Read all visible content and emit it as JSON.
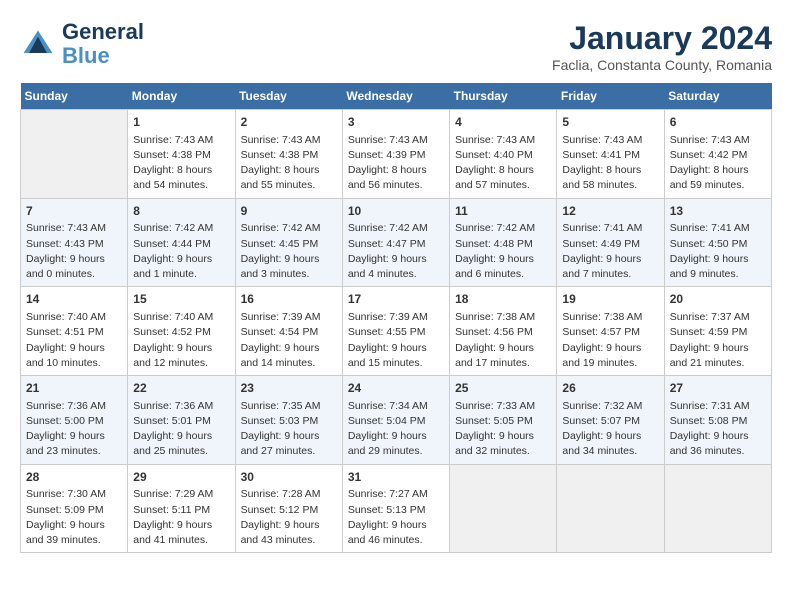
{
  "header": {
    "logo_line1": "General",
    "logo_line2": "Blue",
    "month_year": "January 2024",
    "location": "Faclia, Constanta County, Romania"
  },
  "weekdays": [
    "Sunday",
    "Monday",
    "Tuesday",
    "Wednesday",
    "Thursday",
    "Friday",
    "Saturday"
  ],
  "weeks": [
    [
      {
        "day": "",
        "empty": true
      },
      {
        "day": "1",
        "sunrise": "7:43 AM",
        "sunset": "4:38 PM",
        "daylight": "8 hours and 54 minutes."
      },
      {
        "day": "2",
        "sunrise": "7:43 AM",
        "sunset": "4:38 PM",
        "daylight": "8 hours and 55 minutes."
      },
      {
        "day": "3",
        "sunrise": "7:43 AM",
        "sunset": "4:39 PM",
        "daylight": "8 hours and 56 minutes."
      },
      {
        "day": "4",
        "sunrise": "7:43 AM",
        "sunset": "4:40 PM",
        "daylight": "8 hours and 57 minutes."
      },
      {
        "day": "5",
        "sunrise": "7:43 AM",
        "sunset": "4:41 PM",
        "daylight": "8 hours and 58 minutes."
      },
      {
        "day": "6",
        "sunrise": "7:43 AM",
        "sunset": "4:42 PM",
        "daylight": "8 hours and 59 minutes."
      }
    ],
    [
      {
        "day": "7",
        "sunrise": "7:43 AM",
        "sunset": "4:43 PM",
        "daylight": "9 hours and 0 minutes."
      },
      {
        "day": "8",
        "sunrise": "7:42 AM",
        "sunset": "4:44 PM",
        "daylight": "9 hours and 1 minute."
      },
      {
        "day": "9",
        "sunrise": "7:42 AM",
        "sunset": "4:45 PM",
        "daylight": "9 hours and 3 minutes."
      },
      {
        "day": "10",
        "sunrise": "7:42 AM",
        "sunset": "4:47 PM",
        "daylight": "9 hours and 4 minutes."
      },
      {
        "day": "11",
        "sunrise": "7:42 AM",
        "sunset": "4:48 PM",
        "daylight": "9 hours and 6 minutes."
      },
      {
        "day": "12",
        "sunrise": "7:41 AM",
        "sunset": "4:49 PM",
        "daylight": "9 hours and 7 minutes."
      },
      {
        "day": "13",
        "sunrise": "7:41 AM",
        "sunset": "4:50 PM",
        "daylight": "9 hours and 9 minutes."
      }
    ],
    [
      {
        "day": "14",
        "sunrise": "7:40 AM",
        "sunset": "4:51 PM",
        "daylight": "9 hours and 10 minutes."
      },
      {
        "day": "15",
        "sunrise": "7:40 AM",
        "sunset": "4:52 PM",
        "daylight": "9 hours and 12 minutes."
      },
      {
        "day": "16",
        "sunrise": "7:39 AM",
        "sunset": "4:54 PM",
        "daylight": "9 hours and 14 minutes."
      },
      {
        "day": "17",
        "sunrise": "7:39 AM",
        "sunset": "4:55 PM",
        "daylight": "9 hours and 15 minutes."
      },
      {
        "day": "18",
        "sunrise": "7:38 AM",
        "sunset": "4:56 PM",
        "daylight": "9 hours and 17 minutes."
      },
      {
        "day": "19",
        "sunrise": "7:38 AM",
        "sunset": "4:57 PM",
        "daylight": "9 hours and 19 minutes."
      },
      {
        "day": "20",
        "sunrise": "7:37 AM",
        "sunset": "4:59 PM",
        "daylight": "9 hours and 21 minutes."
      }
    ],
    [
      {
        "day": "21",
        "sunrise": "7:36 AM",
        "sunset": "5:00 PM",
        "daylight": "9 hours and 23 minutes."
      },
      {
        "day": "22",
        "sunrise": "7:36 AM",
        "sunset": "5:01 PM",
        "daylight": "9 hours and 25 minutes."
      },
      {
        "day": "23",
        "sunrise": "7:35 AM",
        "sunset": "5:03 PM",
        "daylight": "9 hours and 27 minutes."
      },
      {
        "day": "24",
        "sunrise": "7:34 AM",
        "sunset": "5:04 PM",
        "daylight": "9 hours and 29 minutes."
      },
      {
        "day": "25",
        "sunrise": "7:33 AM",
        "sunset": "5:05 PM",
        "daylight": "9 hours and 32 minutes."
      },
      {
        "day": "26",
        "sunrise": "7:32 AM",
        "sunset": "5:07 PM",
        "daylight": "9 hours and 34 minutes."
      },
      {
        "day": "27",
        "sunrise": "7:31 AM",
        "sunset": "5:08 PM",
        "daylight": "9 hours and 36 minutes."
      }
    ],
    [
      {
        "day": "28",
        "sunrise": "7:30 AM",
        "sunset": "5:09 PM",
        "daylight": "9 hours and 39 minutes."
      },
      {
        "day": "29",
        "sunrise": "7:29 AM",
        "sunset": "5:11 PM",
        "daylight": "9 hours and 41 minutes."
      },
      {
        "day": "30",
        "sunrise": "7:28 AM",
        "sunset": "5:12 PM",
        "daylight": "9 hours and 43 minutes."
      },
      {
        "day": "31",
        "sunrise": "7:27 AM",
        "sunset": "5:13 PM",
        "daylight": "9 hours and 46 minutes."
      },
      {
        "day": "",
        "empty": true
      },
      {
        "day": "",
        "empty": true
      },
      {
        "day": "",
        "empty": true
      }
    ]
  ]
}
